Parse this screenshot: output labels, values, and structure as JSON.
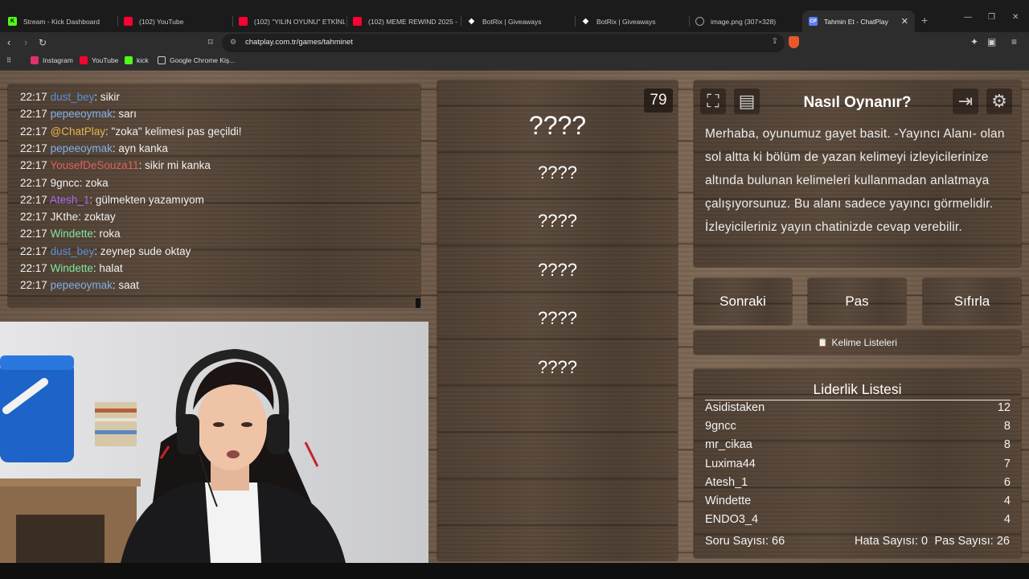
{
  "browser": {
    "tabs": [
      {
        "title": "Stream - Kick Dashboard",
        "icon": "kick-icon",
        "color": "#53fc18"
      },
      {
        "title": "(102) YouTube",
        "icon": "youtube-icon",
        "color": "#ff0033"
      },
      {
        "title": "(102) \"YILIN OYUNU\" ETKİNLİĞ",
        "icon": "youtube-icon",
        "color": "#ff0033"
      },
      {
        "title": "(102) MEME REWIND 2025 - Yo",
        "icon": "youtube-icon",
        "color": "#ff0033"
      },
      {
        "title": "BotRix | Giveaways",
        "icon": "botrix-icon",
        "color": "#ffffff"
      },
      {
        "title": "BotRix | Giveaways",
        "icon": "botrix-icon",
        "color": "#ffffff"
      },
      {
        "title": "image.png (307×328)",
        "icon": "globe-icon",
        "color": "#9aa0a6"
      },
      {
        "title": "Tahmin Et - ChatPlay",
        "icon": "chatplay-icon",
        "color": "#5b7cfa"
      }
    ],
    "url": "chatplay.com.tr/games/tahminet",
    "bookmarks": [
      {
        "label": "Instagram",
        "color": "#e1306c"
      },
      {
        "label": "YouTube",
        "color": "#ff0033"
      },
      {
        "label": "kick",
        "color": "#53fc18"
      },
      {
        "label": "Google Chrome Kiş...",
        "color": "#8a8a8a"
      }
    ]
  },
  "chat": {
    "messages": [
      {
        "time": "22:17",
        "user": "dust_bey",
        "color": "#5a8fd8",
        "text": ": sikir"
      },
      {
        "time": "22:17",
        "user": "pepeeoymak",
        "color": "#7fb0ea",
        "text": ": sarı"
      },
      {
        "time": "22:17",
        "user": "@ChatPlay",
        "color": "#e8b64a",
        "text": ": \"zoka\" kelimesi pas geçildi!"
      },
      {
        "time": "22:17",
        "user": "pepeeoymak",
        "color": "#7fb0ea",
        "text": ": ayn kanka"
      },
      {
        "time": "22:17",
        "user": "YousefDeSouza11",
        "color": "#e0605a",
        "text": ": sikir mi kanka"
      },
      {
        "time": "22:17",
        "user": "9gncc",
        "color": "#f1f1f1",
        "text": ": zoka"
      },
      {
        "time": "22:17",
        "user": "Atesh_1",
        "color": "#a66cf0",
        "text": ": gülmekten yazamıyom"
      },
      {
        "time": "22:17",
        "user": "JKthe",
        "color": "#f1f1f1",
        "text": ": zoktay"
      },
      {
        "time": "22:17",
        "user": "Windette",
        "color": "#7fe6a0",
        "text": ": roka"
      },
      {
        "time": "22:17",
        "user": "dust_bey",
        "color": "#5a8fd8",
        "text": ": zeynep sude oktay"
      },
      {
        "time": "22:17",
        "user": "Windette",
        "color": "#7fe6a0",
        "text": ": halat"
      },
      {
        "time": "22:17",
        "user": "pepeeoymak",
        "color": "#7fb0ea",
        "text": ": saat"
      }
    ]
  },
  "game": {
    "timer": "79",
    "main_word": "????",
    "forbidden_words": [
      "????",
      "????",
      "????",
      "????",
      "????"
    ]
  },
  "howto": {
    "title": "Nasıl Oynanır?",
    "text": "Merhaba, oyunumuz gayet basit. -Yayıncı Alanı- olan sol altta ki bölüm de yazan kelimeyi izleyicilerinize altında bulunan kelimeleri kullanmadan anlatmaya çalışıyorsunuz. Bu alanı sadece yayıncı görmelidir. İzleyicileriniz yayın chatinizde cevap verebilir."
  },
  "buttons": {
    "next": "Sonraki",
    "pass": "Pas",
    "reset": "Sıfırla",
    "word_lists": "Kelime Listeleri",
    "word_lists_icon": "📋"
  },
  "leaderboard": {
    "title": "Liderlik Listesi",
    "rows": [
      {
        "name": "Asidistaken",
        "score": "12"
      },
      {
        "name": "9gncc",
        "score": "8"
      },
      {
        "name": "mr_cikaa",
        "score": "8"
      },
      {
        "name": "Luxima44",
        "score": "7"
      },
      {
        "name": "Atesh_1",
        "score": "6"
      },
      {
        "name": "Windette",
        "score": "4"
      },
      {
        "name": "ENDO3_4",
        "score": "4"
      }
    ],
    "stats": {
      "questions": "Soru Sayısı: 66",
      "errors": "Hata Sayısı: 0",
      "passes": "Pas Sayısı: 26"
    }
  }
}
